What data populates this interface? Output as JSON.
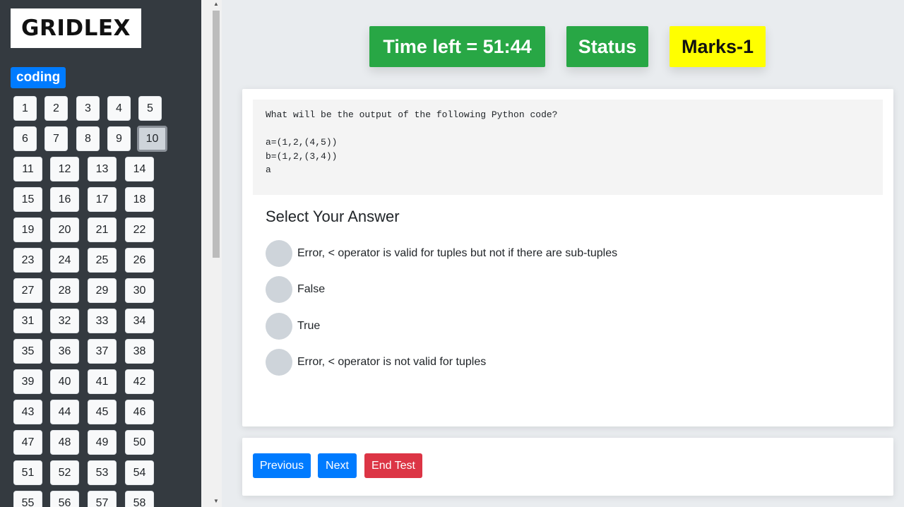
{
  "logo": "GRIDLEX",
  "category": "coding",
  "questions": [
    "1",
    "2",
    "3",
    "4",
    "5",
    "6",
    "7",
    "8",
    "9",
    "10",
    "11",
    "12",
    "13",
    "14",
    "15",
    "16",
    "17",
    "18",
    "19",
    "20",
    "21",
    "22",
    "23",
    "24",
    "25",
    "26",
    "27",
    "28",
    "29",
    "30",
    "31",
    "32",
    "33",
    "34",
    "35",
    "36",
    "37",
    "38",
    "39",
    "40",
    "41",
    "42",
    "43",
    "44",
    "45",
    "46",
    "47",
    "48",
    "49",
    "50",
    "51",
    "52",
    "53",
    "54",
    "55",
    "56",
    "57",
    "58"
  ],
  "current_question": "10",
  "header": {
    "time_left": "Time left = 51:44",
    "status": "Status",
    "marks": "Marks-1"
  },
  "question": {
    "code": "What will be the output of the following Python code?\n\na=(1,2,(4,5))\nb=(1,2,(3,4))\na",
    "select_title": "Select Your Answer",
    "options": [
      "Error, < operator is valid for tuples but not if there are sub-tuples",
      "False",
      "True",
      "Error, < operator is not valid for tuples"
    ]
  },
  "nav": {
    "previous": "Previous",
    "next": "Next",
    "end_test": "End Test"
  },
  "colors": {
    "sidebar_bg": "#343a40",
    "primary": "#007bff",
    "success": "#28a745",
    "danger": "#dc3545",
    "marks_bg": "#ffff00"
  },
  "icons": {
    "scroll_up": "arrow-up-icon",
    "scroll_down": "arrow-down-icon"
  }
}
